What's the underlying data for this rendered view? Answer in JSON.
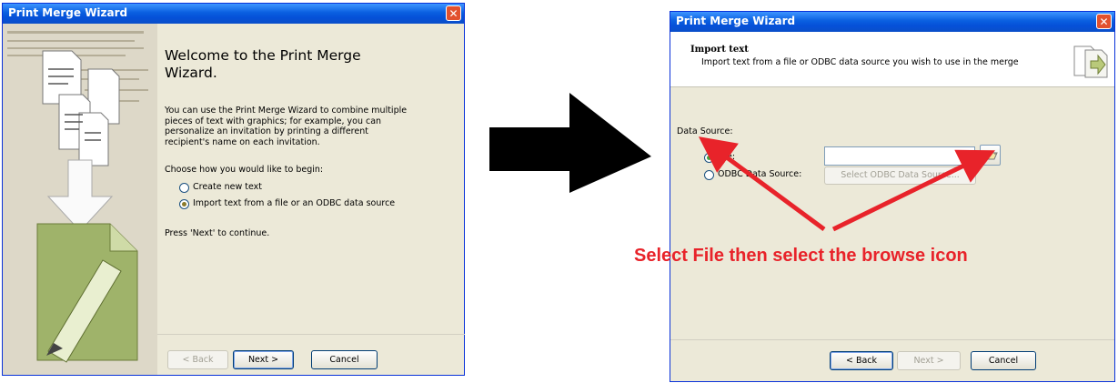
{
  "left_dialog": {
    "title": "Print Merge Wizard",
    "heading": "Welcome to the Print Merge Wizard.",
    "description": "You can use the Print Merge Wizard to combine multiple pieces of text with graphics; for example, you can personalize an invitation by printing a different recipient's name on each invitation.",
    "prompt": "Choose how you would like to begin:",
    "options": [
      {
        "label": "Create new text",
        "selected": false
      },
      {
        "label": "Import text from a file or an ODBC data source",
        "selected": true
      }
    ],
    "footer_note": "Press 'Next' to continue.",
    "buttons": {
      "back": "< Back",
      "next": "Next >",
      "cancel": "Cancel"
    }
  },
  "right_dialog": {
    "title": "Print Merge Wizard",
    "header_title": "Import text",
    "header_subtitle": "Import text from a file or ODBC data source you wish to use in the merge",
    "section_label": "Data Source:",
    "file_option": {
      "label": "File:",
      "selected": true,
      "value": ""
    },
    "odbc_option": {
      "label": "ODBC Data Source:",
      "selected": false,
      "button": "Select ODBC Data Source..."
    },
    "buttons": {
      "back": "< Back",
      "next": "Next >",
      "cancel": "Cancel"
    }
  },
  "annotation": {
    "text": "Select File then select the browse icon",
    "color": "#e8232a"
  },
  "arrow_color": "#000000"
}
